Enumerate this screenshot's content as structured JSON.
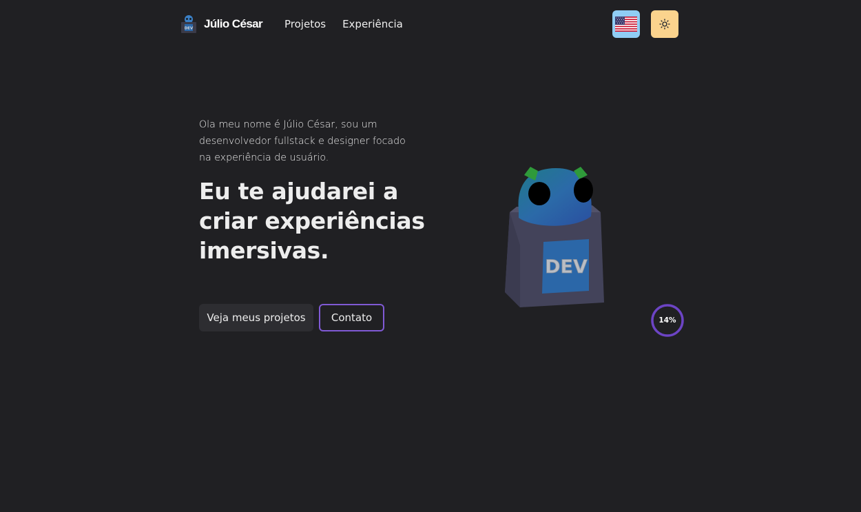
{
  "header": {
    "brand_name": "Júlio César",
    "logo_text": "DEV",
    "nav": [
      {
        "label": "Projetos"
      },
      {
        "label": "Experiência"
      }
    ],
    "language_icon": "us-flag-icon",
    "theme_icon": "sun-icon"
  },
  "hero": {
    "intro": "Ola meu nome é Júlio César, sou um desenvolvedor fullstack e designer focado na experiência de usuário.",
    "headline": "Eu te ajudarei a criar experiências imersivas.",
    "primary_button": "Veja meus projetos",
    "secondary_button": "Contato"
  },
  "model": {
    "label": "DEV"
  },
  "loader": {
    "progress_text": "14%",
    "progress_value": 0.14
  },
  "colors": {
    "background": "#202023",
    "accent": "#805ad5",
    "lang_button": "#90cdf4",
    "theme_button": "#fbd38d"
  }
}
